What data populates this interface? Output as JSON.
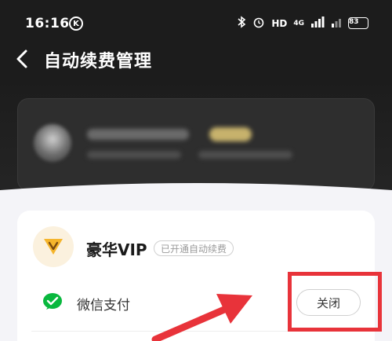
{
  "status_bar": {
    "time": "16:16",
    "k_badge": "K",
    "network": "HD",
    "signal": "4G",
    "battery": "83"
  },
  "nav": {
    "title": "自动续费管理"
  },
  "subscription": {
    "title": "豪华VIP",
    "status_badge": "已开通自动续费",
    "payment_method": "微信支付",
    "close_label": "关闭"
  },
  "colors": {
    "background_dark": "#1c1c1c",
    "card_bg": "#ffffff",
    "wechat_green": "#09b83e",
    "annotation_red": "#e8333a",
    "vip_gold": "#e5a91e"
  },
  "icons": {
    "back": "chevron-left-icon",
    "vip": "vip-crown-icon",
    "wechat": "wechat-icon",
    "bluetooth": "bluetooth-icon",
    "alarm": "alarm-icon"
  }
}
